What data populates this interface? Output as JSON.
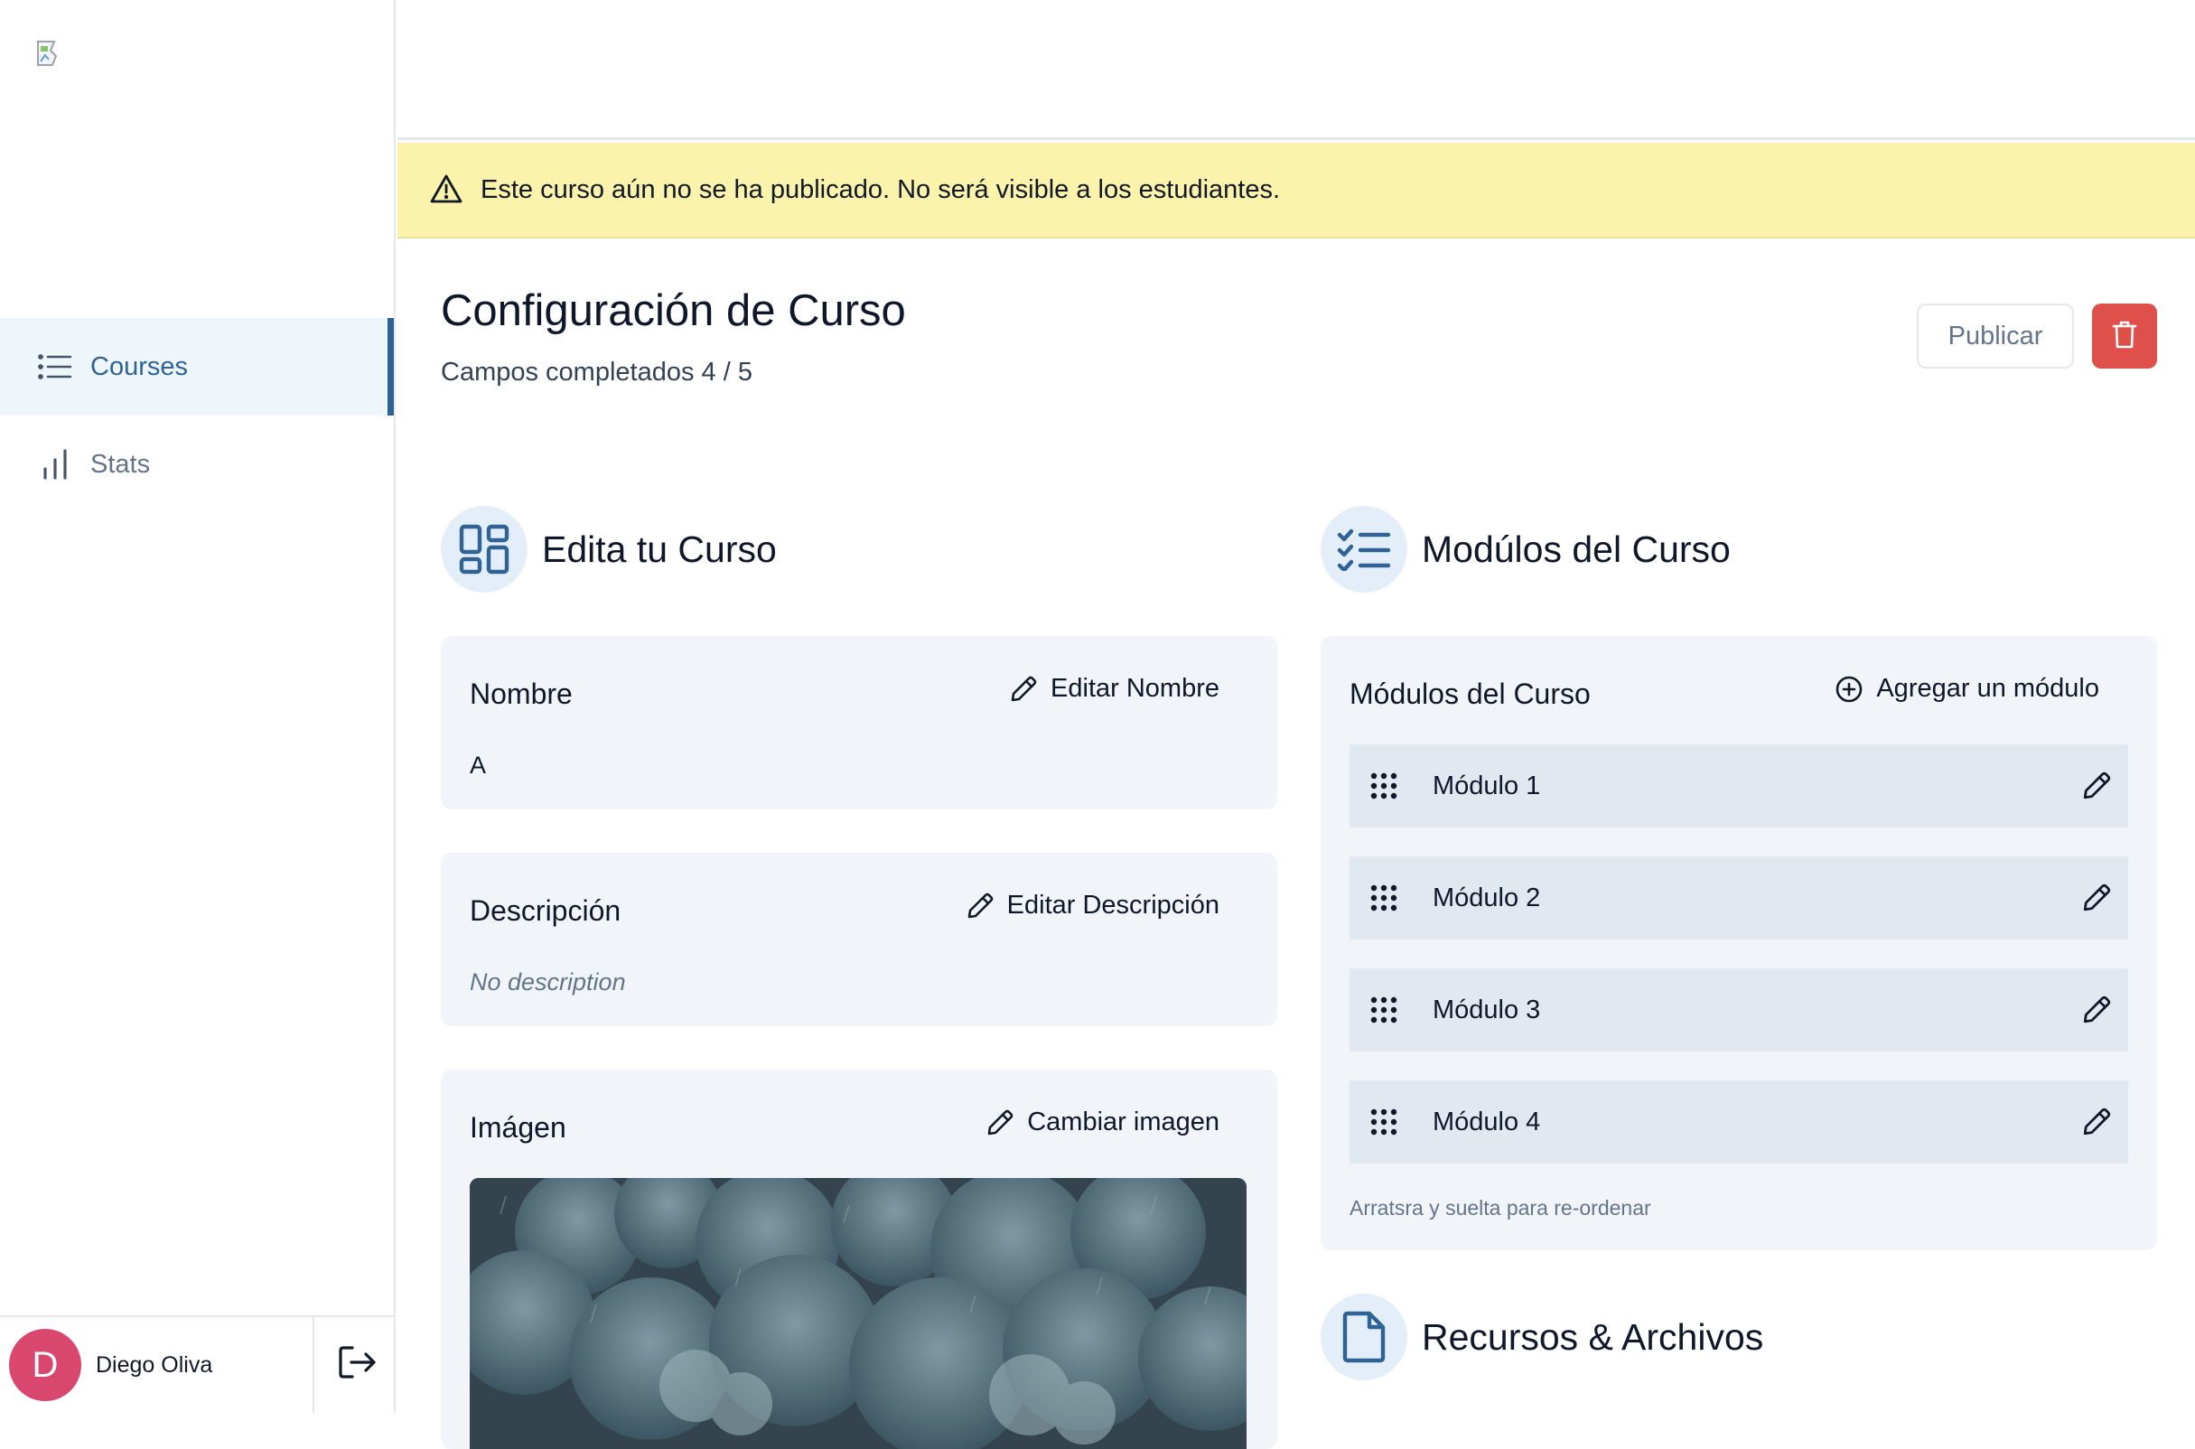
{
  "sidebar": {
    "nav": [
      {
        "label": "Courses",
        "icon": "list-icon",
        "active": true
      },
      {
        "label": "Stats",
        "icon": "bar-chart-icon",
        "active": false
      }
    ],
    "user": {
      "initial": "D",
      "name": "Diego Oliva",
      "avatar_color": "#d9476f"
    }
  },
  "banner": {
    "text": "Este curso aún no se ha publicado. No será visible a los estudiantes.",
    "color": "#fbf2ab"
  },
  "header": {
    "title": "Configuración de Curso",
    "progress": "Campos completados 4 / 5",
    "publish_label": "Publicar"
  },
  "edit_section": {
    "title": "Edita tu Curso",
    "name_card": {
      "label": "Nombre",
      "action": "Editar Nombre",
      "value": "A"
    },
    "description_card": {
      "label": "Descripción",
      "action": "Editar Descripción",
      "value": "No description"
    },
    "image_card": {
      "label": "Imágen",
      "action": "Cambiar imagen"
    }
  },
  "modules_section": {
    "title": "Modúlos del Curso",
    "card_title": "Módulos del Curso",
    "add_label": "Agregar un módulo",
    "modules": [
      "Módulo 1",
      "Módulo 2",
      "Módulo 3",
      "Módulo 4"
    ],
    "hint": "Arratsra y suelta para re-ordenar"
  },
  "resources_section": {
    "title": "Recursos & Archivos"
  },
  "colors": {
    "accent": "#2f6396",
    "danger": "#e0504a",
    "card_bg": "#f1f5f9"
  }
}
